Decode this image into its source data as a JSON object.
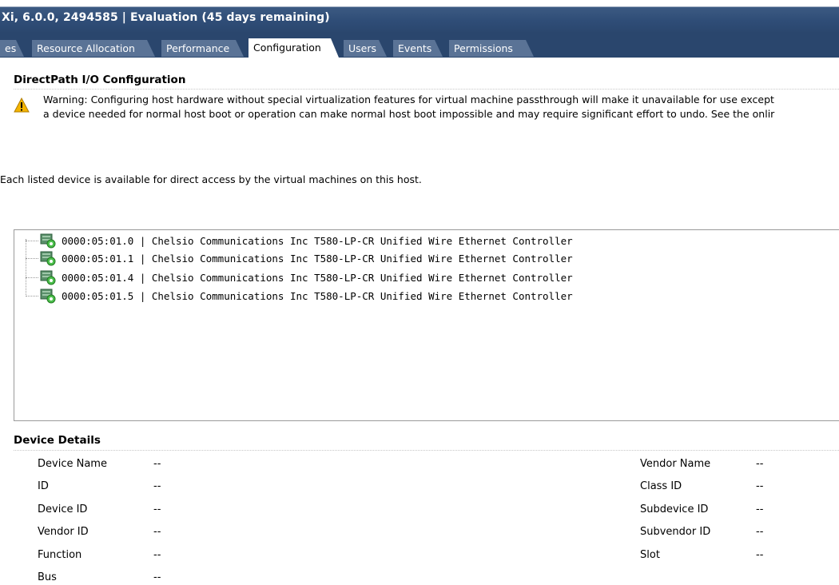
{
  "header": {
    "title": "Xi, 6.0.0, 2494585 | Evaluation (45 days remaining)"
  },
  "tabs": [
    {
      "label": "es",
      "active": false
    },
    {
      "label": "Resource Allocation",
      "active": false
    },
    {
      "label": "Performance",
      "active": false
    },
    {
      "label": "Configuration",
      "active": true
    },
    {
      "label": "Users",
      "active": false
    },
    {
      "label": "Events",
      "active": false
    },
    {
      "label": "Permissions",
      "active": false
    }
  ],
  "directpath": {
    "title": "DirectPath I/O Configuration",
    "warning_icon": "warning-triangle-icon",
    "warning_line1": "Warning: Configuring host hardware without special virtualization features for virtual machine passthrough will make it unavailable for use except",
    "warning_line2": "a device needed for normal host boot or operation can make normal host boot impossible and may require significant effort to undo. See the onlir",
    "info": "Each listed device is available for direct access by the virtual machines on this host."
  },
  "devices": [
    {
      "label": "0000:05:01.0 | Chelsio Communications Inc T580-LP-CR Unified Wire Ethernet Controller",
      "icon": "pci-device-icon"
    },
    {
      "label": "0000:05:01.1 | Chelsio Communications Inc T580-LP-CR Unified Wire Ethernet Controller",
      "icon": "pci-device-icon"
    },
    {
      "label": "0000:05:01.4 | Chelsio Communications Inc T580-LP-CR Unified Wire Ethernet Controller",
      "icon": "pci-device-icon"
    },
    {
      "label": "0000:05:01.5 | Chelsio Communications Inc T580-LP-CR Unified Wire Ethernet Controller",
      "icon": "pci-device-icon"
    }
  ],
  "details": {
    "title": "Device Details",
    "left": [
      {
        "label": "Device Name",
        "value": "--"
      },
      {
        "label": "ID",
        "value": "--"
      },
      {
        "label": "Device ID",
        "value": "--"
      },
      {
        "label": "Vendor ID",
        "value": "--"
      },
      {
        "label": "Function",
        "value": "--"
      },
      {
        "label": "Bus",
        "value": "--"
      }
    ],
    "right": [
      {
        "label": "Vendor Name",
        "value": "--"
      },
      {
        "label": "Class ID",
        "value": "--"
      },
      {
        "label": "Subdevice ID",
        "value": "--"
      },
      {
        "label": "Subvendor ID",
        "value": "--"
      },
      {
        "label": "Slot",
        "value": "--"
      }
    ]
  },
  "colors": {
    "header_bg": "#2f4d77",
    "tab_bg": "#5a7396",
    "tab_active_bg": "#ffffff"
  }
}
